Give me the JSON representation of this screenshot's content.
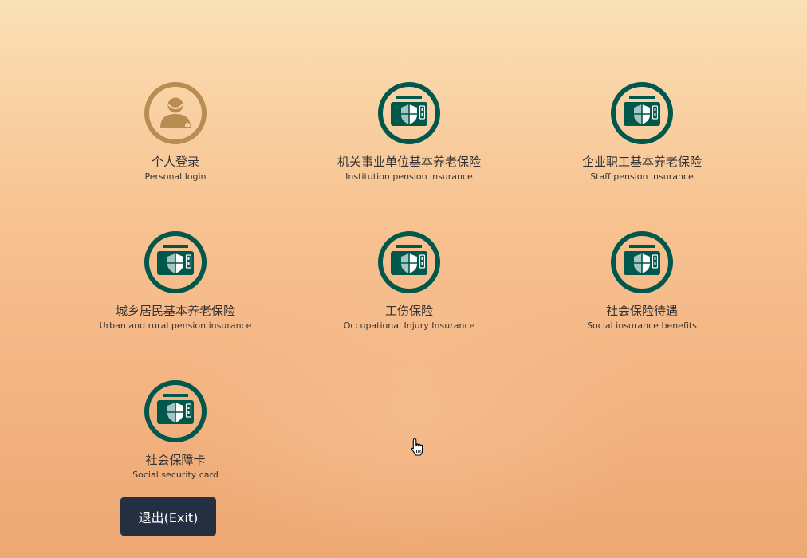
{
  "colors": {
    "accent_teal": "#00574b",
    "personal_icon": "#b98c52",
    "exit_button_bg": "#243041",
    "text": "#333333"
  },
  "tiles": [
    {
      "title": "个人登录",
      "subtitle": "Personal login",
      "icon": "user-icon"
    },
    {
      "title": "机关事业单位基本养老保险",
      "subtitle": "Institution pension insurance",
      "icon": "insurance-card-icon"
    },
    {
      "title": "企业职工基本养老保险",
      "subtitle": "Staff pension insurance",
      "icon": "insurance-card-icon"
    },
    {
      "title": "城乡居民基本养老保险",
      "subtitle": "Urban and rural pension insurance",
      "icon": "insurance-card-icon"
    },
    {
      "title": "工伤保险",
      "subtitle": "Occupational Injury Insurance",
      "icon": "insurance-card-icon"
    },
    {
      "title": "社会保险待遇",
      "subtitle": "Social insurance benefits",
      "icon": "insurance-card-icon"
    },
    {
      "title": "社会保障卡",
      "subtitle": "Social security card",
      "icon": "insurance-card-icon"
    }
  ],
  "exit_button": {
    "label": "退出(Exit)"
  },
  "cursor": {
    "icon": "hand-pointer-icon"
  }
}
